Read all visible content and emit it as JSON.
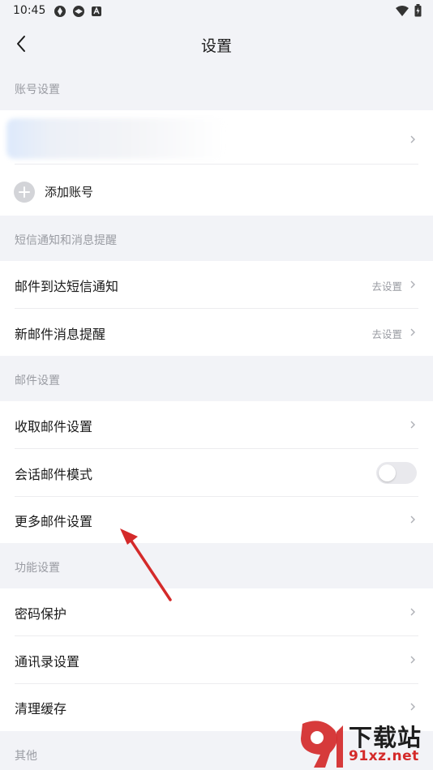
{
  "status_bar": {
    "time": "10:45"
  },
  "nav": {
    "title": "设置"
  },
  "sections": {
    "account": {
      "header": "账号设置",
      "add_account": "添加账号"
    },
    "sms": {
      "header": "短信通知和消息提醒",
      "rows": [
        {
          "label": "邮件到达短信通知",
          "value": "去设置"
        },
        {
          "label": "新邮件消息提醒",
          "value": "去设置"
        }
      ]
    },
    "mail": {
      "header": "邮件设置",
      "rows": [
        {
          "label": "收取邮件设置"
        },
        {
          "label": "会话邮件模式",
          "toggle": false
        },
        {
          "label": "更多邮件设置"
        }
      ]
    },
    "feature": {
      "header": "功能设置",
      "rows": [
        {
          "label": "密码保护"
        },
        {
          "label": "通讯录设置"
        },
        {
          "label": "清理缓存"
        }
      ]
    },
    "other": {
      "header": "其他"
    }
  },
  "watermark": {
    "top": "下载站",
    "bottom": "91xz.net"
  },
  "colors": {
    "annotation_arrow": "#d42a2a",
    "background": "#f2f3f7",
    "muted_text": "#9a9ca3"
  }
}
